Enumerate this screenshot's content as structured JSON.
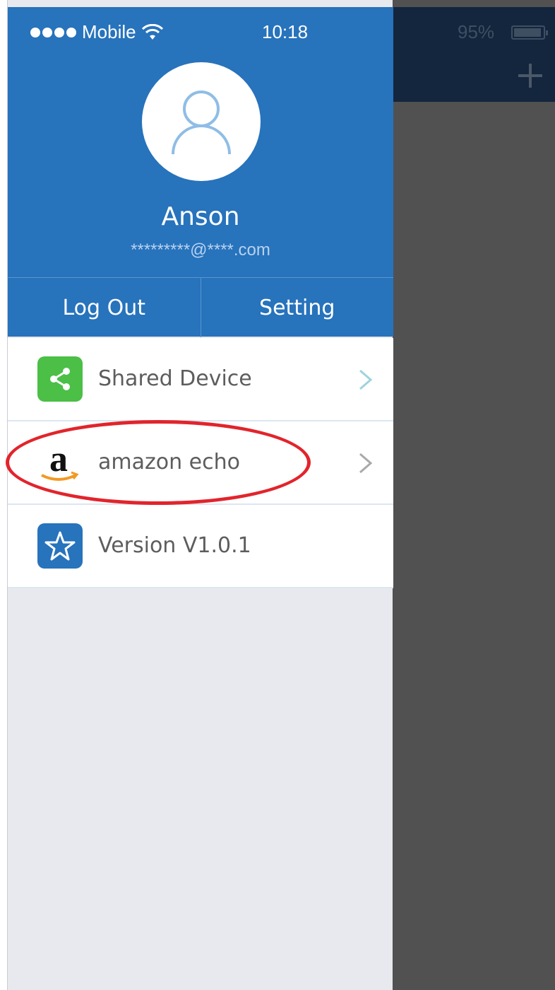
{
  "status_bar": {
    "carrier": "Mobile",
    "time": "10:18",
    "battery": "95%"
  },
  "profile": {
    "name": "Anson",
    "email": "*********@****.com"
  },
  "actions": {
    "logout_label": "Log Out",
    "setting_label": "Setting"
  },
  "menu": {
    "items": [
      {
        "label": "Shared Device",
        "icon": "share-icon",
        "icon_color": "#4bbf46"
      },
      {
        "label": "amazon echo",
        "icon": "amazon-logo-icon"
      },
      {
        "label": "Version V1.0.1",
        "icon": "star-icon",
        "icon_color": "#2773bc"
      }
    ]
  },
  "colors": {
    "header": "#2773bc",
    "annotation": "#e2242c"
  }
}
